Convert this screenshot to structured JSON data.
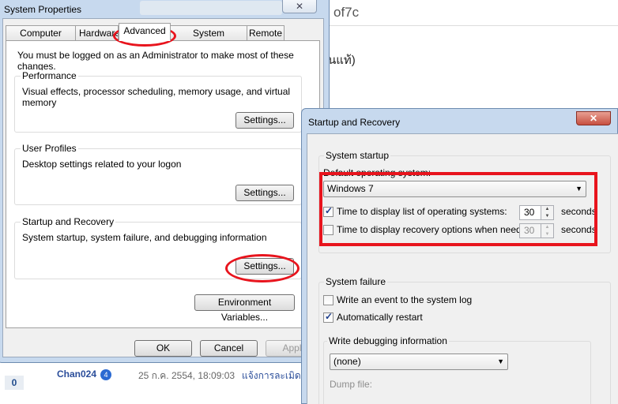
{
  "background": {
    "address_fragment": "of7c",
    "thai_fragment": "นแท้)",
    "comment_count": "0",
    "username": "Chan024",
    "user_badge": "4",
    "post_date": "25 ก.ค. 2554, 18:09:03",
    "report_link": "แจ้งการละเมิด"
  },
  "system_properties": {
    "title": "System Properties",
    "close_glyph": "✕",
    "tabs": [
      {
        "label": "Computer Name"
      },
      {
        "label": "Hardware"
      },
      {
        "label": "Advanced"
      },
      {
        "label": "System Protection"
      },
      {
        "label": "Remote"
      }
    ],
    "admin_notice": "You must be logged on as an Administrator to make most of these changes.",
    "performance": {
      "title": "Performance",
      "description": "Visual effects, processor scheduling, memory usage, and virtual memory",
      "button": "Settings..."
    },
    "user_profiles": {
      "title": "User Profiles",
      "description": "Desktop settings related to your logon",
      "button": "Settings..."
    },
    "startup_recovery": {
      "title": "Startup and Recovery",
      "description": "System startup, system failure, and debugging information",
      "button": "Settings..."
    },
    "env_button": "Environment Variables...",
    "ok": "OK",
    "cancel": "Cancel",
    "apply": "Apply"
  },
  "startup_and_recovery": {
    "title": "Startup and Recovery",
    "close_glyph": "✕",
    "system_startup": {
      "title": "System startup",
      "default_os_label": "Default operating system:",
      "default_os_value": "Windows 7",
      "display_list_label": "Time to display list of operating systems:",
      "display_list_checked": true,
      "display_list_value": "30",
      "display_recovery_label": "Time to display recovery options when needed:",
      "display_recovery_checked": false,
      "display_recovery_value": "30",
      "seconds": "seconds"
    },
    "system_failure": {
      "title": "System failure",
      "write_event_label": "Write an event to the system log",
      "write_event_checked": false,
      "auto_restart_label": "Automatically restart",
      "auto_restart_checked": true,
      "debug_info_title": "Write debugging information",
      "debug_value": "(none)",
      "dump_file_label": "Dump file:"
    }
  },
  "annotation_color": "#e8141d"
}
